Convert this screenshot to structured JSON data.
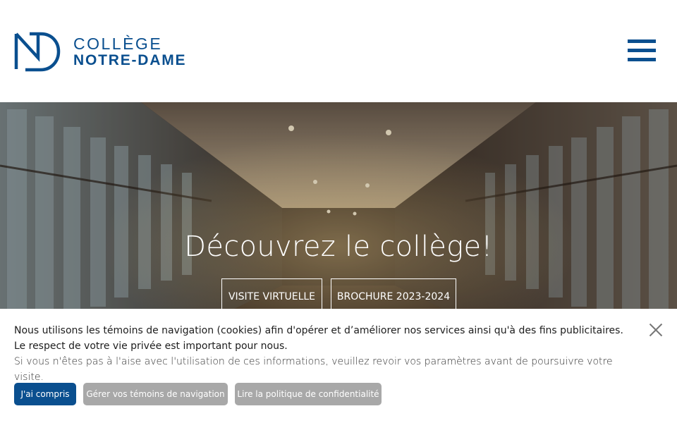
{
  "header": {
    "logo_line1": "COLLÈGE",
    "logo_line2": "NOTRE-DAME",
    "logo_monogram": "ND"
  },
  "hero": {
    "title": "Découvrez le collège!",
    "buttons": [
      {
        "label": "VISITE VIRTUELLE"
      },
      {
        "label": "BROCHURE 2023-2024"
      }
    ]
  },
  "cookie_banner": {
    "text_main": "Nous utilisons les témoins de navigation (cookies) afin d'opérer et d’améliorer nos services ainsi qu'à des fins publicitaires. Le respect de votre vie privée est important pour nous.",
    "text_secondary": "Si vous n'êtes pas à l'aise avec l'utilisation de ces informations, veuillez revoir vos paramètres avant de poursuivre votre visite.",
    "accept_label": "J'ai compris",
    "manage_label": "Gérer vos témoins de navigation",
    "policy_label": "Lire la politique de confidentialité"
  },
  "colors": {
    "brand_blue": "#0a4f8f",
    "secondary_button_gray": "#a8a8a8"
  },
  "icons": {
    "menu": "hamburger-menu-icon",
    "close": "close-icon"
  }
}
